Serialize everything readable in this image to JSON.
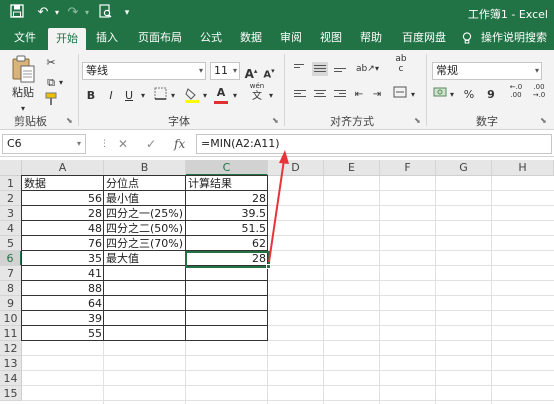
{
  "window": {
    "title": "工作簿1 - Excel"
  },
  "quick_access": {
    "save_icon": "save-icon",
    "undo_icon": "undo-icon",
    "redo_icon": "redo-icon",
    "preview_icon": "print-preview-icon"
  },
  "tabs": [
    "文件",
    "开始",
    "插入",
    "页面布局",
    "公式",
    "数据",
    "审阅",
    "视图",
    "帮助",
    "百度网盘",
    "操作说明搜索"
  ],
  "active_tab": "开始",
  "ribbon": {
    "clipboard": {
      "label": "剪贴板",
      "paste_label": "粘贴"
    },
    "font": {
      "label": "字体",
      "font_name": "等线",
      "font_size": "11",
      "grow": "A",
      "shrink": "A",
      "bold": "B",
      "italic": "I",
      "underline": "U",
      "font_color_letter": "A",
      "phonetic_top": "wén",
      "phonetic_bottom": "文"
    },
    "alignment": {
      "label": "对齐方式",
      "wrap": "ab",
      "wrap_sub": "c"
    },
    "number": {
      "label": "数字",
      "format": "常规",
      "percent": "%",
      "comma": "9",
      "inc_decimal": "←.0 .00",
      "dec_decimal": ".00 →.0"
    }
  },
  "formula_bar": {
    "name_box": "C6",
    "cancel": "✕",
    "enter": "✓",
    "fx": "fx",
    "formula": "=MIN(A2:A11)"
  },
  "sheet": {
    "columns": [
      "A",
      "B",
      "C",
      "D",
      "E",
      "F",
      "G",
      "H"
    ],
    "rows": [
      "1",
      "2",
      "3",
      "4",
      "5",
      "6",
      "7",
      "8",
      "9",
      "10",
      "11",
      "12",
      "13",
      "14",
      "15"
    ],
    "selected_cell": "C6",
    "A": [
      "数据",
      "56",
      "28",
      "48",
      "76",
      "35",
      "41",
      "88",
      "64",
      "39",
      "55"
    ],
    "B": [
      "分位点",
      "最小值",
      "四分之一(25%)",
      "四分之二(50%)",
      "四分之三(70%)",
      "最大值"
    ],
    "C": [
      "计算结果",
      "28",
      "39.5",
      "51.5",
      "62",
      "28"
    ]
  },
  "colors": {
    "accent": "#217346",
    "annotation_arrow": "#e8333a"
  }
}
